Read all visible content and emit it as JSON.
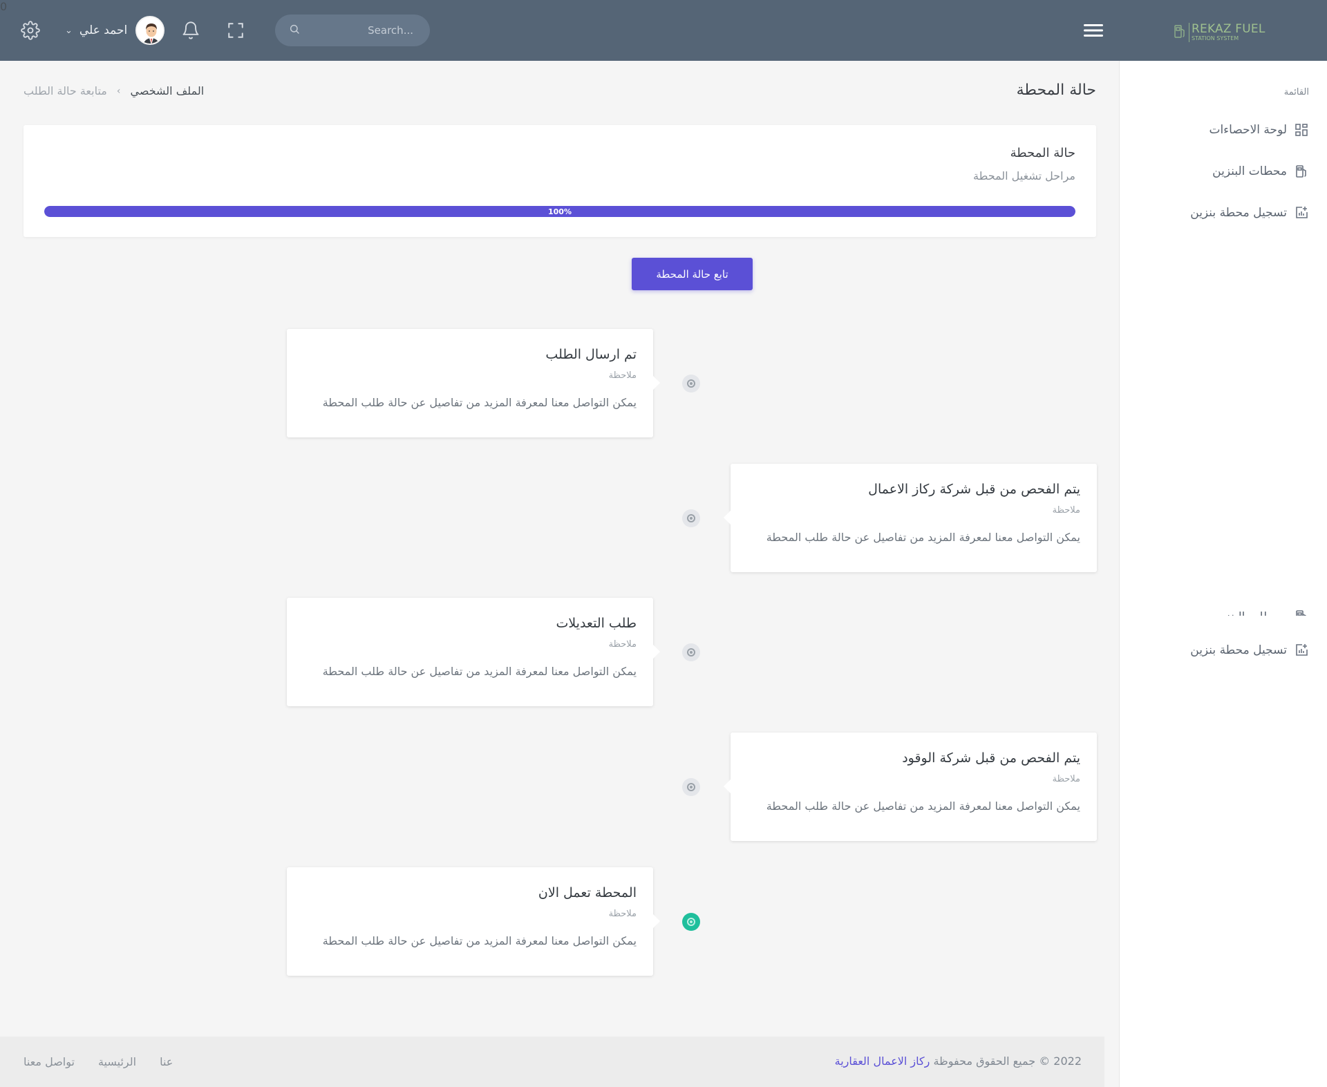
{
  "topbar": {
    "user_name": "احمد علي",
    "notifications_count": "0",
    "search_placeholder": "Search...",
    "logo_title": "REKAZ FUEL",
    "logo_subtitle": "STATION SYSTEM"
  },
  "sidebar": {
    "title": "القائمة",
    "items": [
      {
        "label": "لوحة الاحصاءات",
        "icon": "dashboard-icon"
      },
      {
        "label": "محطات البنزين",
        "icon": "fuel-pump-icon"
      },
      {
        "label": "تسجيل محطة بنزين",
        "icon": "add-chart-icon"
      }
    ],
    "ghost_items": [
      {
        "label": "محطات البنزين",
        "icon": "fuel-pump-icon"
      },
      {
        "label": "تسجيل محطة بنزين",
        "icon": "add-chart-icon"
      }
    ]
  },
  "header": {
    "page_title": "حالة المحطة",
    "breadcrumb": [
      "متابعة حالة الطلب",
      "الملف الشخصي"
    ]
  },
  "status_card": {
    "title": "حالة المحطة",
    "subtitle": "مراحل تشغيل المحطة",
    "progress_percent": 100,
    "progress_label": "100%"
  },
  "track_button": {
    "label": "تابع حالة المحطة"
  },
  "timeline": [
    {
      "title": "تم ارسال الطلب",
      "note_label": "ملاحظة",
      "description": "يمكن التواصل معنا لمعرفة المزيد من تفاصيل عن حالة طلب المحطة",
      "side": "left",
      "active": false
    },
    {
      "title": "يتم الفحص من قبل شركة ركاز الاعمال",
      "note_label": "ملاحظة",
      "description": "يمكن التواصل معنا لمعرفة المزيد من تفاصيل عن حالة طلب المحطة",
      "side": "right",
      "active": false
    },
    {
      "title": "طلب التعديلات",
      "note_label": "ملاحظة",
      "description": "يمكن التواصل معنا لمعرفة المزيد من تفاصيل عن حالة طلب المحطة",
      "side": "left",
      "active": false
    },
    {
      "title": "يتم الفحص من قبل شركة الوقود",
      "note_label": "ملاحظة",
      "description": "يمكن التواصل معنا لمعرفة المزيد من تفاصيل عن حالة طلب المحطة",
      "side": "right",
      "active": false
    },
    {
      "title": "المحطة تعمل الان",
      "note_label": "ملاحظة",
      "description": "يمكن التواصل معنا لمعرفة المزيد من تفاصيل عن حالة طلب المحطة",
      "side": "left",
      "active": true
    }
  ],
  "footer": {
    "copyright_prefix": "2022 © جميع الحقوق محفوظة",
    "copyright_brand": "ركاز الاعمال العقارية",
    "links": [
      "عنا",
      "الرئيسية",
      "تواصل معنا"
    ]
  },
  "colors": {
    "topbar": "#556576",
    "accent": "#5b50d6",
    "active_dot": "#1fbf9c",
    "badge": "#f15b6c",
    "logo": "#9fc08f"
  }
}
